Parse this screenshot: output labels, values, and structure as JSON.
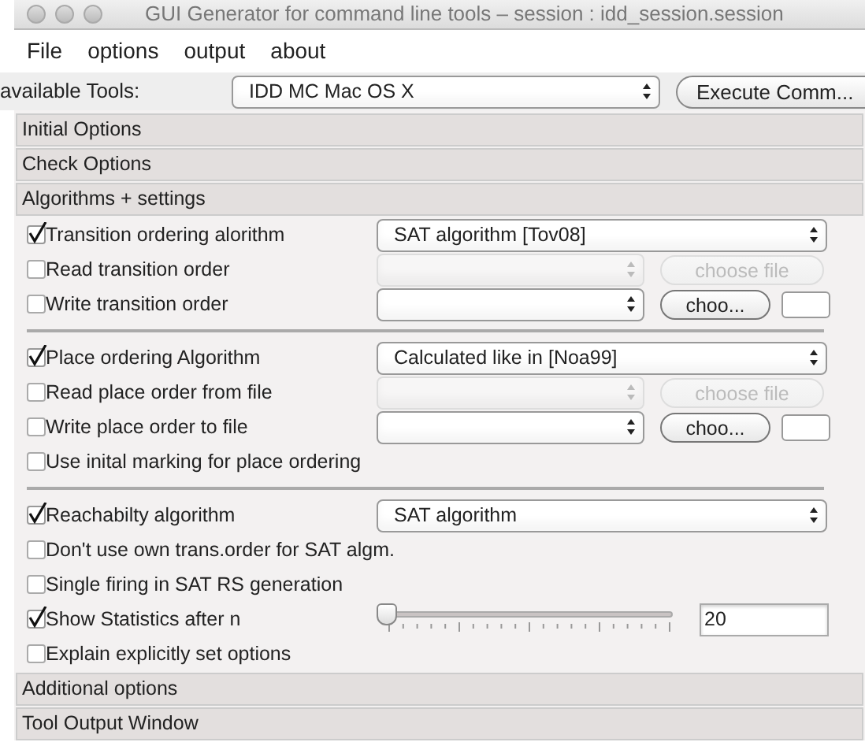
{
  "window": {
    "title": "GUI Generator for command line tools – session : idd_session.session"
  },
  "menu": [
    "File",
    "options",
    "output",
    "about"
  ],
  "toolbar": {
    "label": "available Tools:",
    "tool": "IDD MC Mac OS X",
    "button": "Execute Comm..."
  },
  "sections_before": [
    {
      "title": "Initial Options"
    },
    {
      "title": "Check Options"
    }
  ],
  "algorithms": {
    "title": "Algorithms + settings",
    "groups": [
      [
        {
          "kind": "algorithm",
          "label": "Transition ordering alorithm",
          "checked": true,
          "value": "SAT algorithm [Tov08]"
        },
        {
          "kind": "file",
          "label": "Read transition order",
          "checked": false,
          "disabled": true,
          "button": "choose file",
          "extra_box": false
        },
        {
          "kind": "file",
          "label": "Write transition order",
          "checked": false,
          "disabled": false,
          "button": "choo...",
          "extra_box": true
        }
      ],
      [
        {
          "kind": "algorithm",
          "label": "Place ordering Algorithm",
          "checked": true,
          "value": "Calculated like in [Noa99]"
        },
        {
          "kind": "file",
          "label": "Read place order from file",
          "checked": false,
          "disabled": true,
          "button": "choose file",
          "extra_box": false
        },
        {
          "kind": "file",
          "label": "Write place order to file",
          "checked": false,
          "disabled": false,
          "button": "choo...",
          "extra_box": true
        },
        {
          "kind": "check",
          "label": "Use inital marking for place ordering",
          "checked": false
        }
      ],
      [
        {
          "kind": "algorithm",
          "label": "Reachabilty algorithm",
          "checked": true,
          "value": "SAT algorithm"
        },
        {
          "kind": "check",
          "label": "Don't use own trans.order for SAT algm.",
          "checked": false
        },
        {
          "kind": "check",
          "label": "Single firing in SAT RS generation",
          "checked": false
        },
        {
          "kind": "slider",
          "label": "Show Statistics after n",
          "checked": true,
          "level": 0,
          "value": "20"
        },
        {
          "kind": "check",
          "label": "Explain explicitly set options",
          "checked": false
        }
      ]
    ]
  },
  "sections_after": [
    {
      "title": "Additional options"
    },
    {
      "title": "Tool Output Window"
    }
  ]
}
